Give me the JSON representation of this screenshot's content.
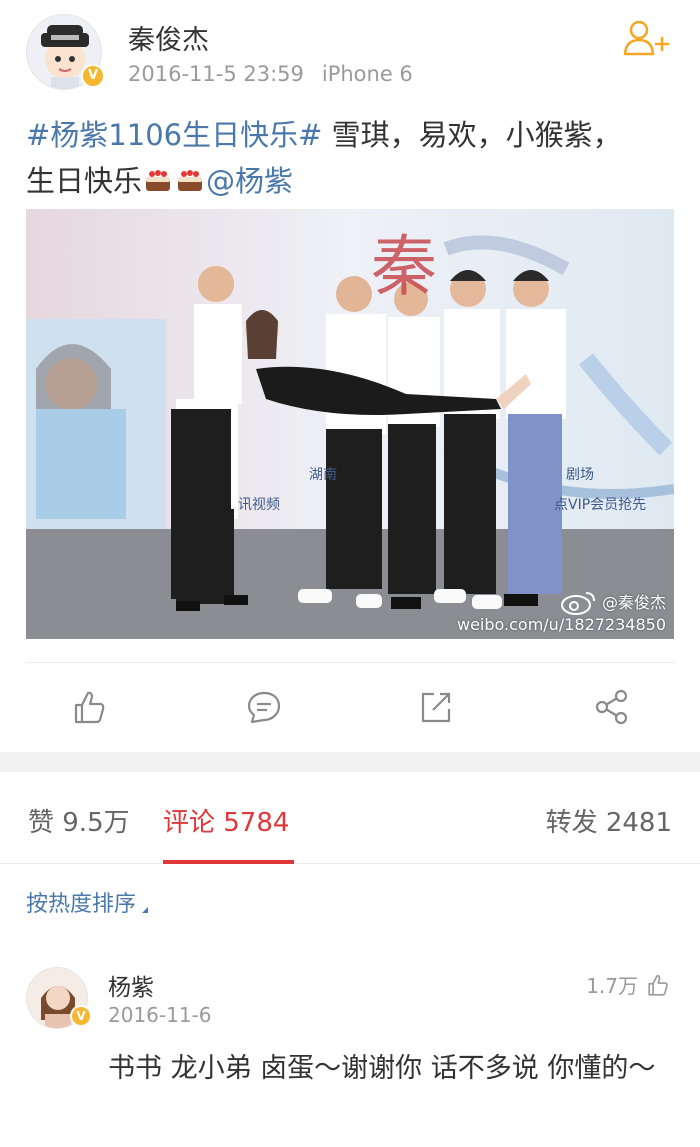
{
  "post": {
    "author": "秦俊杰",
    "date": "2016-11-5 23:59",
    "device": "iPhone 6",
    "hashtag": "#杨紫1106生日快乐#",
    "text_line1": " 雪琪，易欢，小猴紫，",
    "text_line2": "生日快乐",
    "mention": "@杨紫",
    "photo": {
      "watermark_handle": "@秦俊杰",
      "watermark_url": "weibo.com/u/1827234850",
      "banner_text_1": "湖南",
      "banner_text_2": "讯视频",
      "banner_text_3": "剧场",
      "banner_text_4": "点VIP会员抢先"
    }
  },
  "actions": {
    "icons": [
      "like-icon",
      "comment-icon",
      "share-icon",
      "forward-icon"
    ]
  },
  "tabs": {
    "likes_label": "赞 9.5万",
    "comments_label": "评论 5784",
    "reposts_label": "转发 2481"
  },
  "sort": {
    "label": "按热度排序"
  },
  "comment": {
    "name": "杨紫",
    "date": "2016-11-6",
    "likes": "1.7万",
    "text": "书书 龙小弟 卤蛋～谢谢你 话不多说 你懂的～"
  },
  "colors": {
    "accent_red": "#e0373a",
    "link_blue": "#4a78ab",
    "verify_gold": "#f6b730",
    "follow_orange": "#f5a623"
  }
}
